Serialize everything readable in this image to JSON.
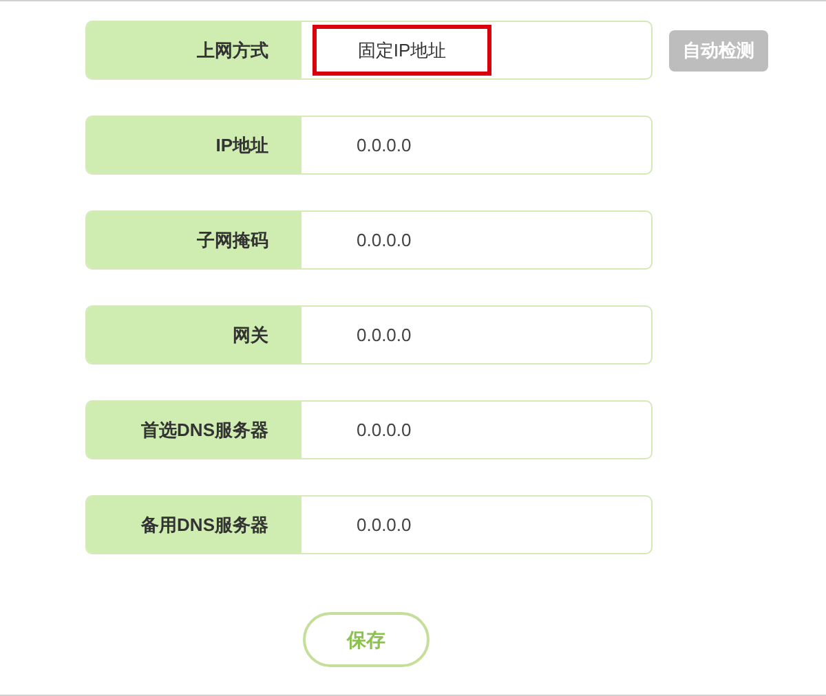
{
  "rows": [
    {
      "label": "上网方式",
      "value": "固定IP地址",
      "kind": "select"
    },
    {
      "label": "IP地址",
      "value": "0.0.0.0",
      "kind": "text"
    },
    {
      "label": "子网掩码",
      "value": "0.0.0.0",
      "kind": "text"
    },
    {
      "label": "网关",
      "value": "0.0.0.0",
      "kind": "text"
    },
    {
      "label": "首选DNS服务器",
      "value": "0.0.0.0",
      "kind": "text"
    },
    {
      "label": "备用DNS服务器",
      "value": "0.0.0.0",
      "kind": "text"
    }
  ],
  "detect_button": "自动检测",
  "save_button": "保存"
}
